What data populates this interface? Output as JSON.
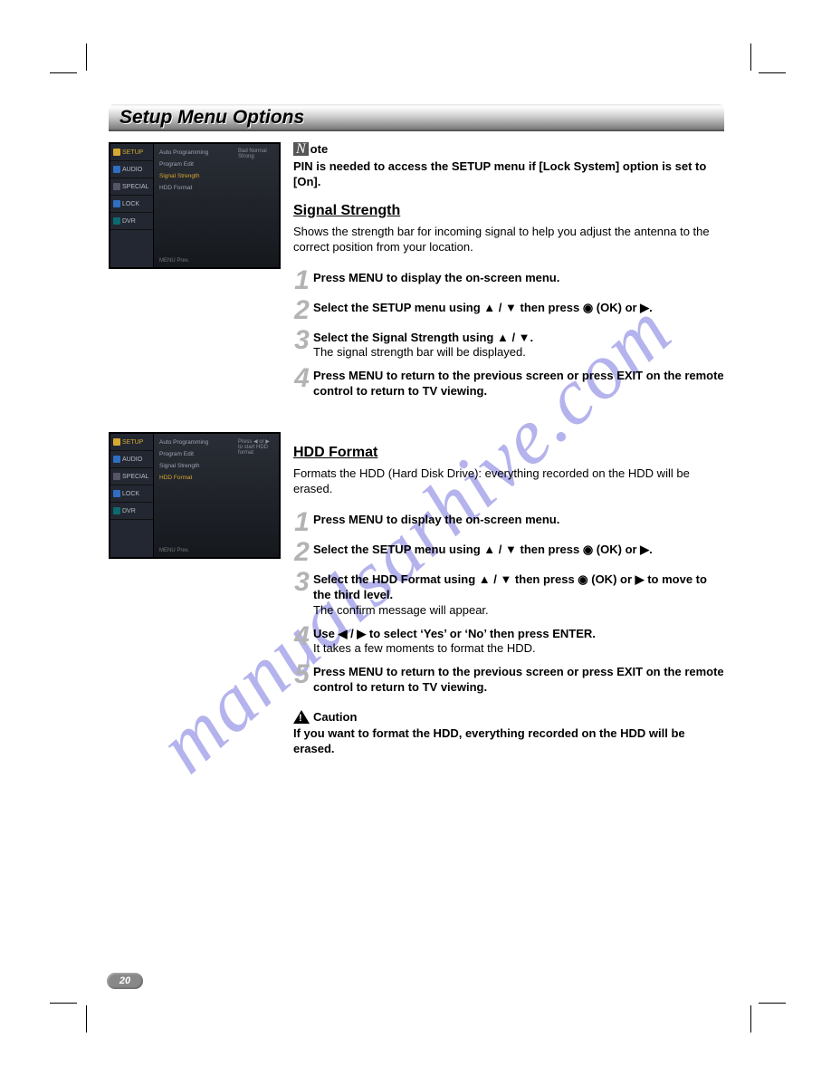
{
  "page_number": "20",
  "title": "Setup Menu Options",
  "watermark": "manualsarhive.com",
  "screenshot1": {
    "tabs": [
      "SETUP",
      "AUDIO",
      "SPECIAL",
      "LOCK",
      "DVR"
    ],
    "items": [
      "Auto Programming",
      "Program Edit",
      "Signal Strength",
      "HDD Format"
    ],
    "selected": "Signal Strength",
    "right_labels": "Bad    Normal    Strong",
    "hint": "MENU Prev."
  },
  "screenshot2": {
    "tabs": [
      "SETUP",
      "AUDIO",
      "SPECIAL",
      "LOCK",
      "DVR"
    ],
    "items": [
      "Auto Programming",
      "Program Edit",
      "Signal Strength",
      "HDD Format"
    ],
    "selected": "HDD Format",
    "right_labels": "Press ◀ or ▶ to start HDD format",
    "hint": "MENU Prev."
  },
  "note": {
    "label": "ote",
    "prefix": "N",
    "body": "PIN is needed to access the SETUP menu if [Lock System] option is set to [On]."
  },
  "signal": {
    "heading": "Signal Strength",
    "intro": "Shows the strength bar for incoming signal to help you adjust the antenna to the correct position from your location.",
    "steps": [
      {
        "n": "1",
        "main": "Press MENU to display the on-screen menu."
      },
      {
        "n": "2",
        "main": "Select the SETUP menu using ▲ / ▼ then press ◉ (OK) or ▶."
      },
      {
        "n": "3",
        "main": "Select the Signal Strength using ▲ / ▼.",
        "sub": "The signal strength bar will be displayed."
      },
      {
        "n": "4",
        "main": "Press MENU to return to the previous screen or press EXIT on the remote control to return to TV viewing."
      }
    ]
  },
  "hdd": {
    "heading": "HDD Format",
    "intro": "Formats the HDD (Hard Disk Drive): everything recorded on the HDD will be erased.",
    "steps": [
      {
        "n": "1",
        "main": "Press MENU to display the on-screen menu."
      },
      {
        "n": "2",
        "main": "Select the SETUP menu using ▲ / ▼ then press ◉ (OK) or ▶."
      },
      {
        "n": "3",
        "main": "Select the HDD Format using ▲ / ▼ then press ◉ (OK) or ▶ to move to the third level.",
        "sub": "The confirm message will appear."
      },
      {
        "n": "4",
        "main": "Use ◀ / ▶ to select ‘Yes’ or ‘No’ then press ENTER.",
        "sub": "It takes a few moments to format the HDD."
      },
      {
        "n": "5",
        "main": "Press MENU to return to the previous screen or press EXIT on the remote control to return to TV viewing."
      }
    ],
    "caution_label": "Caution",
    "caution_body": "If you want to format the HDD, everything recorded on the HDD will be erased."
  }
}
